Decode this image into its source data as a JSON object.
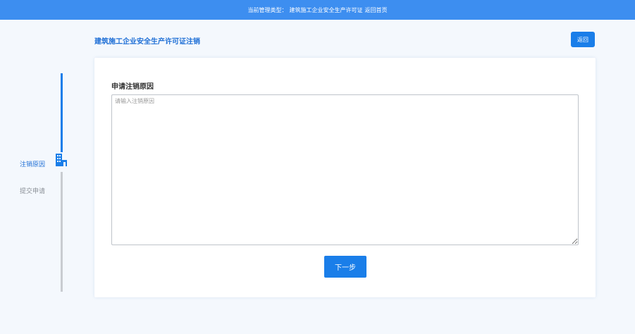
{
  "header": {
    "management_type_label": "当前管理类型：",
    "management_type_value": "建筑施工企业安全生产许可证",
    "home_link": "返回首页"
  },
  "page": {
    "title": "建筑施工企业安全生产许可证注销",
    "back_label": "返回"
  },
  "steps": [
    {
      "label": "注销原因",
      "status": "active"
    },
    {
      "label": "提交申请",
      "status": "pending"
    }
  ],
  "form": {
    "section_title": "申请注销原因",
    "reason_placeholder": "请输入注销原因",
    "reason_value": "",
    "next_label": "下一步"
  },
  "colors": {
    "primary": "#1a7ee9",
    "header_bg": "#3d8ef0",
    "page_bg": "#f4f8fd",
    "inactive": "#c9ccd1"
  },
  "icons": {
    "step_active_icon": "building-icon"
  }
}
